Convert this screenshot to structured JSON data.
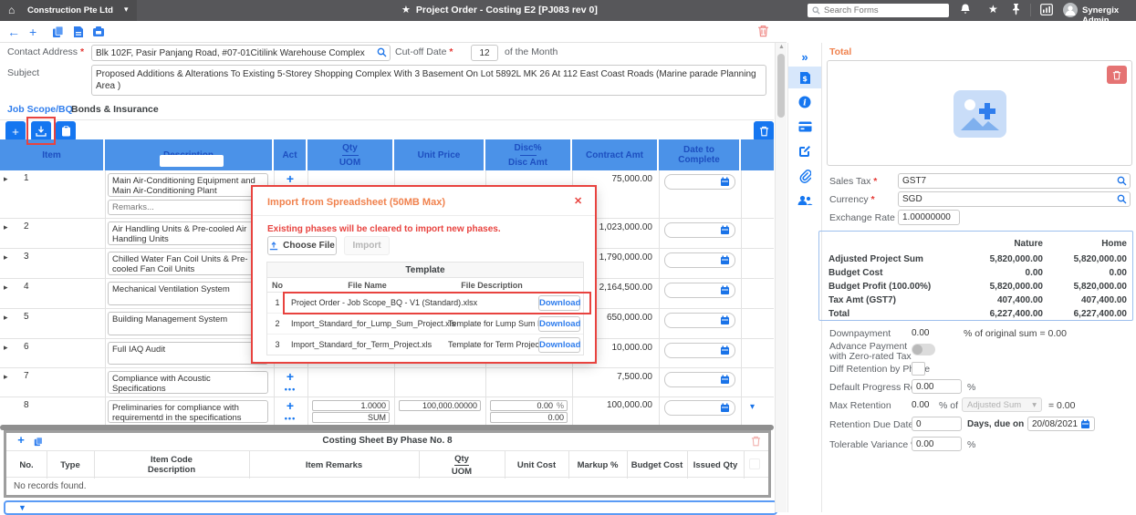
{
  "glyphs": {
    "home": "⌂",
    "caret": "▾",
    "star": "★",
    "back": "←",
    "plus": "+",
    "dots": "•••",
    "expand": "▸",
    "collapse": "»",
    "up": "▲",
    "down": "▼",
    "close": "✕",
    "percent": "%"
  },
  "navbar": {
    "company": "Construction Pte Ltd",
    "title": "Project Order - Costing E2 [PJ083 rev 0]",
    "search_placeholder": "Search Forms",
    "user_name": "Synergix Admin"
  },
  "form": {
    "contact_address_label": "Contact Address",
    "contact_address_value": "Blk 102F, Pasir Panjang Road, #07-01Citilink Warehouse Complex",
    "cutoff_label": "Cut-off Date",
    "cutoff_value": "12",
    "cutoff_suffix": "of the Month",
    "subject_label": "Subject",
    "subject_value": "Proposed Additions & Alterations To Existing 5-Storey Shopping Complex With 3 Basement On Lot 5892L MK 26 At 112 East Coast Roads (Marine parade Planning Area )"
  },
  "tabs": {
    "job": "Job Scope/BQ",
    "bonds": "Bonds & Insurance"
  },
  "job_table": {
    "headers": {
      "item": "Item",
      "description": "Description",
      "act": "Act",
      "qty": "Qty",
      "uom": "UOM",
      "unit_price": "Unit Price",
      "disc_pct": "Disc%",
      "disc_amt": "Disc Amt",
      "contract_amt": "Contract Amt",
      "date_to_complete": "Date to Complete"
    },
    "remarks_placeholder": "Remarks...",
    "rows": [
      {
        "no": "1",
        "description": "Main  Air-Conditioning  Equipment  and  Main  Air-Conditioning Plant",
        "contract_amt": "75,000.00"
      },
      {
        "no": "2",
        "description": "Air Handling Units & Pre-cooled Air Handling Units",
        "contract_amt": "1,023,000.00"
      },
      {
        "no": "3",
        "description": "Chilled Water Fan Coil Units & Pre-cooled Fan Coil Units",
        "contract_amt": "1,790,000.00"
      },
      {
        "no": "4",
        "description": "Mechanical Ventilation System",
        "contract_amt": "2,164,500.00"
      },
      {
        "no": "5",
        "description": "Building Management System",
        "contract_amt": "650,000.00"
      },
      {
        "no": "6",
        "description": "Full IAQ Audit",
        "contract_amt": "10,000.00"
      },
      {
        "no": "7",
        "description": "Compliance with Acoustic Specifications",
        "contract_amt": "7,500.00"
      },
      {
        "no": "8",
        "description": "Preliminaries for compliance with requirementd in the specifications",
        "qty": "1.0000",
        "uom": "SUM",
        "unit_price": "100,000.00000",
        "disc_pct": "0.00",
        "disc_amt": "0.00",
        "contract_amt": "100,000.00"
      }
    ]
  },
  "modal": {
    "title": "Import from Spreadsheet (50MB Max)",
    "warning": "Existing phases will be cleared to import new phases.",
    "choose_file_label": "Choose File",
    "import_label": "Import",
    "template_header": "Template",
    "col_no": "No",
    "col_file_name": "File Name",
    "col_file_desc": "File Description",
    "download_label": "Download",
    "files": [
      {
        "no": "1",
        "name": "Project Order - Job Scope_BQ - V1 (Standard).xlsx",
        "desc": ""
      },
      {
        "no": "2",
        "name": "Import_Standard_for_Lump_Sum_Project.xls",
        "desc": "Template for Lump Sum Project"
      },
      {
        "no": "3",
        "name": "Import_Standard_for_Term_Project.xls",
        "desc": "Template for Term Project"
      }
    ]
  },
  "right_panel": {
    "title": "Total",
    "sales_tax_label": "Sales Tax",
    "sales_tax_value": "GST7",
    "currency_label": "Currency",
    "currency_value": "SGD",
    "exchange_rate_label": "Exchange Rate",
    "exchange_rate_value": "1.00000000",
    "summary": {
      "col_nature": "Nature",
      "col_home": "Home",
      "rows": [
        {
          "label": "Adjusted Project Sum",
          "nature": "5,820,000.00",
          "home": "5,820,000.00"
        },
        {
          "label": "Budget Cost",
          "nature": "0.00",
          "home": "0.00"
        },
        {
          "label": "Budget Profit (100.00%)",
          "nature": "5,820,000.00",
          "home": "5,820,000.00"
        },
        {
          "label": "Tax Amt  (GST7)",
          "nature": "407,400.00",
          "home": "407,400.00"
        },
        {
          "label": "Total",
          "nature": "6,227,400.00",
          "home": "6,227,400.00"
        }
      ]
    },
    "downpayment_label": "Downpayment",
    "downpayment_value": "0.00",
    "downpayment_suffix": "% of original sum =  0.00",
    "advance_label": "Advance Payment with Zero-rated Tax",
    "diff_retention_label": "Diff Retention by Phase",
    "default_progress_label": "Default Progress Retention",
    "default_progress_value": "0.00",
    "max_retention_label": "Max Retention",
    "max_retention_value": "0.00",
    "max_retention_mid": "% of",
    "max_retention_select": "Adjusted Sum",
    "max_retention_eq": "=  0.00",
    "retention_due_label": "Retention Due Date",
    "retention_due_value": "0",
    "retention_due_mid": "Days, due on",
    "retention_due_date": "20/08/2021",
    "tolerable_label": "Tolerable Variance %",
    "tolerable_value": "0.00",
    "percent": "%"
  },
  "costing_sheet": {
    "title": "Costing Sheet By Phase No. 8",
    "h_no": "No.",
    "h_type": "Type",
    "h_item_code_1": "Item Code",
    "h_item_code_2": "Description",
    "h_remarks": "Item Remarks",
    "h_qty": "Qty",
    "h_uom": "UOM",
    "h_unit_cost": "Unit Cost",
    "h_markup": "Markup %",
    "h_budget_cost": "Budget Cost",
    "h_issued_qty": "Issued Qty",
    "empty_text": "No records found."
  }
}
